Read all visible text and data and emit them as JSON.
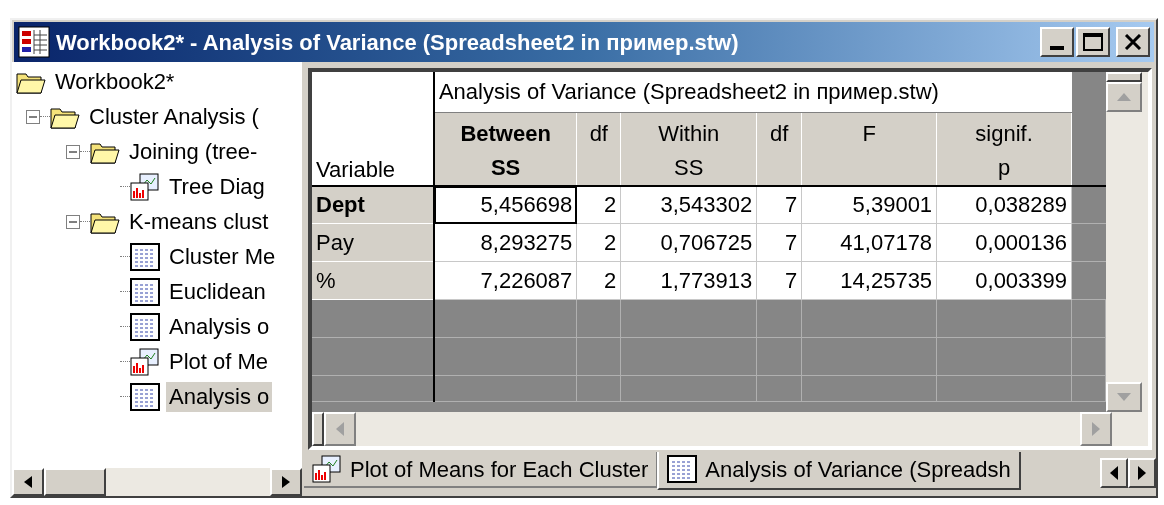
{
  "window": {
    "title": "Workbook2* - Analysis of Variance (Spreadsheet2 in пример.stw)"
  },
  "tree": [
    {
      "label": "Workbook2*",
      "kind": "folder",
      "selected": false,
      "children": [
        {
          "label": "Cluster Analysis (",
          "kind": "folder",
          "expanded": true,
          "selected": false,
          "children": [
            {
              "label": "Joining (tree-",
              "kind": "folder",
              "expanded": true,
              "selected": false,
              "children": [
                {
                  "label": "Tree Diag",
                  "kind": "graph",
                  "selected": false
                }
              ]
            },
            {
              "label": "K-means clust",
              "kind": "folder",
              "expanded": true,
              "selected": false,
              "children": [
                {
                  "label": "Cluster Me",
                  "kind": "sheet",
                  "selected": false
                },
                {
                  "label": "Euclidean",
                  "kind": "sheet",
                  "selected": false
                },
                {
                  "label": "Analysis o",
                  "kind": "sheet",
                  "selected": false
                },
                {
                  "label": "Plot of Me",
                  "kind": "graph",
                  "selected": false
                },
                {
                  "label": "Analysis o",
                  "kind": "sheet",
                  "selected": true
                }
              ]
            }
          ]
        }
      ]
    }
  ],
  "table": {
    "title": "Analysis of Variance (Spreadsheet2 in пример.stw)",
    "corner": "Variable",
    "columns": [
      {
        "label": "Between\nSS",
        "selected": true
      },
      {
        "label": "df",
        "selected": false
      },
      {
        "label": "Within\nSS",
        "selected": false
      },
      {
        "label": "df",
        "selected": false
      },
      {
        "label": "F",
        "selected": false
      },
      {
        "label": "signif.\np",
        "selected": false
      }
    ],
    "rows": [
      {
        "label": "Dept",
        "selected": true,
        "cells": [
          "5,456698",
          "2",
          "3,543302",
          "7",
          "5,39001",
          "0,038289"
        ]
      },
      {
        "label": "Pay",
        "selected": false,
        "cells": [
          "8,293275",
          "2",
          "0,706725",
          "7",
          "41,07178",
          "0,000136"
        ]
      },
      {
        "label": "%",
        "selected": false,
        "cells": [
          "7,226087",
          "2",
          "1,773913",
          "7",
          "14,25735",
          "0,003399"
        ]
      }
    ]
  },
  "tabs": [
    {
      "label": "Plot of Means for Each Cluster",
      "kind": "graph",
      "selected": false
    },
    {
      "label": "Analysis of Variance (Spreadsh",
      "kind": "sheet",
      "selected": true
    }
  ]
}
